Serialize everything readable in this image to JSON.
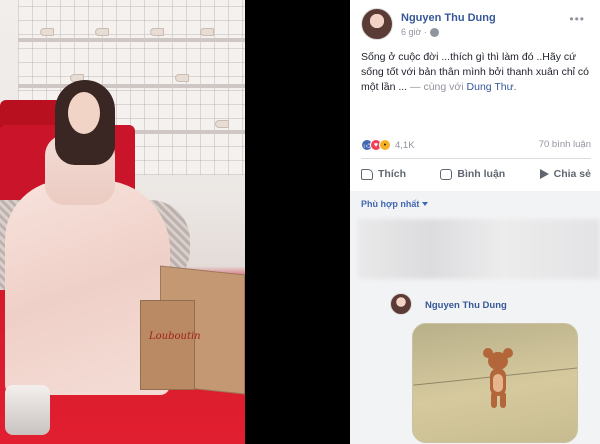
{
  "post": {
    "author": "Nguyen Thu Dung",
    "time": "6 giờ ·",
    "text_main": "Sống ở cuộc đời ...thích gì thì làm đó ..Hãy cứ sống tốt với bản thân mình bởi thanh xuân chỉ có một lần ... ",
    "text_with": "— cùng với ",
    "tagged": "Dung Thư.",
    "reaction_count": "4,1K",
    "comment_count": "70 bình luận",
    "reactions": [
      "like",
      "love",
      "wow"
    ]
  },
  "actions": {
    "like_label": "Thích",
    "comment_label": "Bình luận",
    "share_label": "Chia sẻ"
  },
  "comments": {
    "sort_label": "Phù hợp nhất",
    "reply_author": "Nguyen Thu Dung"
  },
  "photo": {
    "bag_logo": "Louboutin"
  },
  "colors": {
    "link": "#365899",
    "muted": "#90949c",
    "text": "#1d2129",
    "comments_bg": "#f2f3f5",
    "carpet_red": "#e11f30"
  }
}
